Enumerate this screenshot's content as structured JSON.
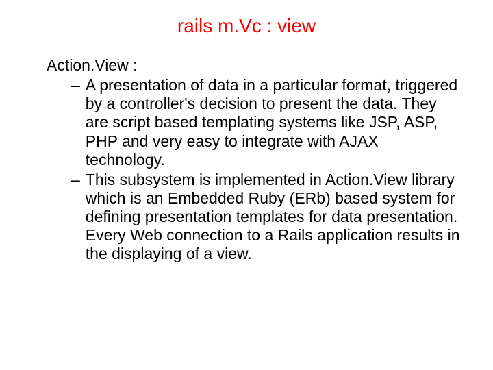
{
  "title": "rails m.Vc : view",
  "heading": "Action.View :",
  "bullets": {
    "b1": "A presentation of data in a particular format, triggered by a controller's decision to present the data. They are script based templating systems like JSP, ASP, PHP and very easy to integrate with AJAX technology.",
    "b2": "This subsystem is implemented in Action.View library which is an Embedded Ruby (ERb) based system for defining presentation templates for data presentation. Every Web connection to a Rails application results in the displaying of a view."
  },
  "dash": "–"
}
